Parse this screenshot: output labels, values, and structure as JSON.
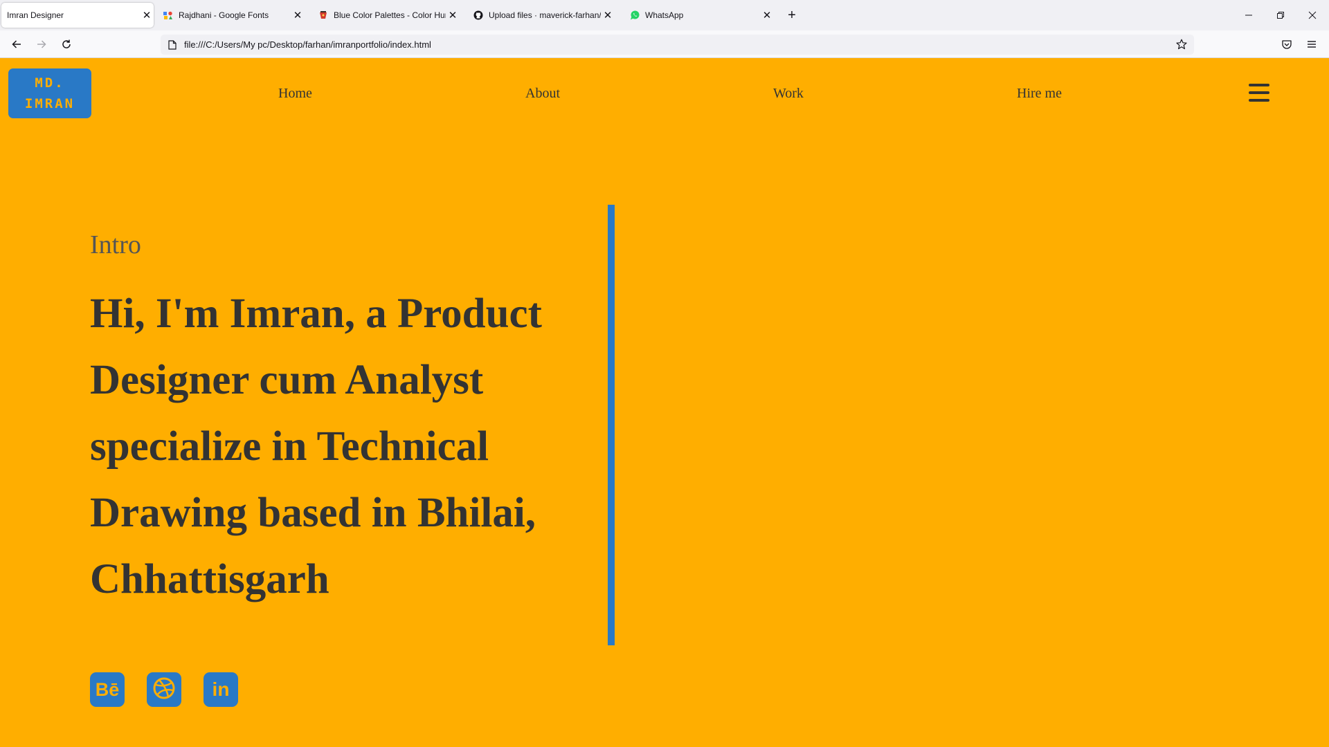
{
  "browser": {
    "tabs": [
      {
        "title": "Imran Designer",
        "icon": "page-icon",
        "active": true
      },
      {
        "title": "Rajdhani - Google Fonts",
        "icon": "google-fonts-icon",
        "active": false
      },
      {
        "title": "Blue Color Palettes - Color Hunt",
        "icon": "color-hunt-icon",
        "active": false
      },
      {
        "title": "Upload files · maverick-farhan/p",
        "icon": "github-icon",
        "active": false
      },
      {
        "title": "WhatsApp",
        "icon": "whatsapp-icon",
        "active": false
      }
    ],
    "close_glyph": "✕",
    "new_tab_glyph": "+",
    "url": "file:///C:/Users/My pc/Desktop/farhan/imranportfolio/index.html"
  },
  "page": {
    "logo": {
      "line1": "MD.",
      "line2": "IMRAN"
    },
    "nav": {
      "home": "Home",
      "about": "About",
      "work": "Work",
      "hire": "Hire me"
    },
    "intro_label": "Intro",
    "headline": "Hi, I'm Imran, a Product Designer cum Analyst specialize in Technical Drawing based in Bhilai, Chhattisgarh",
    "social": {
      "behance": "Bē",
      "dribbble_icon": "dribbble-icon",
      "linkedin": "in"
    }
  },
  "colors": {
    "page_background": "#ffae00",
    "accent_blue": "#2979c6",
    "text_dark": "#333333",
    "text_muted": "#555555"
  }
}
